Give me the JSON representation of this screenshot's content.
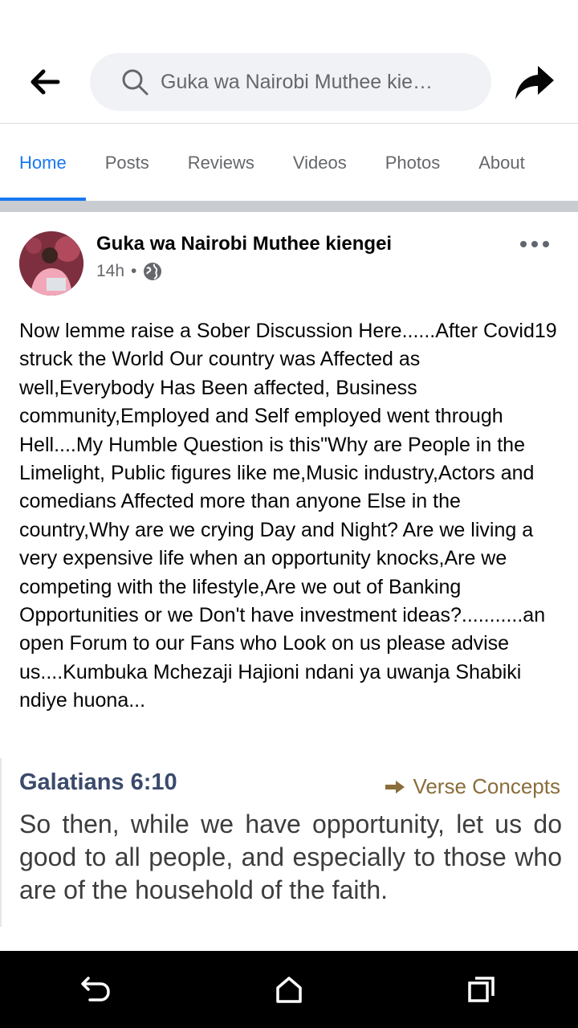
{
  "header": {
    "search_text": "Guka wa Nairobi Muthee kie…",
    "back_icon": "arrow-left-icon",
    "search_icon": "search-icon",
    "share_icon": "share-icon"
  },
  "tabs": [
    {
      "label": "Home",
      "active": true
    },
    {
      "label": "Posts",
      "active": false
    },
    {
      "label": "Reviews",
      "active": false
    },
    {
      "label": "Videos",
      "active": false
    },
    {
      "label": "Photos",
      "active": false
    },
    {
      "label": "About",
      "active": false
    }
  ],
  "post": {
    "author": "Guka wa Nairobi Muthee kiengei",
    "time": "14h",
    "separator": "•",
    "privacy_icon": "globe-icon",
    "more_icon": "more-horizontal-icon",
    "text": "Now lemme raise a Sober Discussion Here......After Covid19 struck the World Our country was Affected as well,Everybody Has Been affected, Business community,Employed and Self employed went through Hell....My Humble Question is this\"Why are People in the Limelight, Public figures like me,Music industry,Actors and comedians Affected more than anyone Else in the country,Why are we crying Day and Night? Are we living a very expensive life when an opportunity knocks,Are we competing with the lifestyle,Are we out of Banking Opportunities or we Don't have investment ideas?...........an open Forum to our Fans who Look on us please advise us....Kumbuka Mchezaji Hajioni ndani ya uwanja Shabiki ndiye huona...",
    "verse": {
      "reference": "Galatians 6:10",
      "concepts_label": "Verse Concepts",
      "text": "So then, while we have opportunity, let us do good to all people, and especially to those who are of the household of the faith."
    }
  },
  "system_nav": {
    "back_icon": "system-back-icon",
    "home_icon": "system-home-icon",
    "recents_icon": "system-recents-icon"
  },
  "colors": {
    "accent": "#1877f2",
    "tab_inactive": "#65676b",
    "divider": "#c9ccd1",
    "verse_reference": "#3a4a6b",
    "verse_concepts": "#8a6d3b"
  }
}
